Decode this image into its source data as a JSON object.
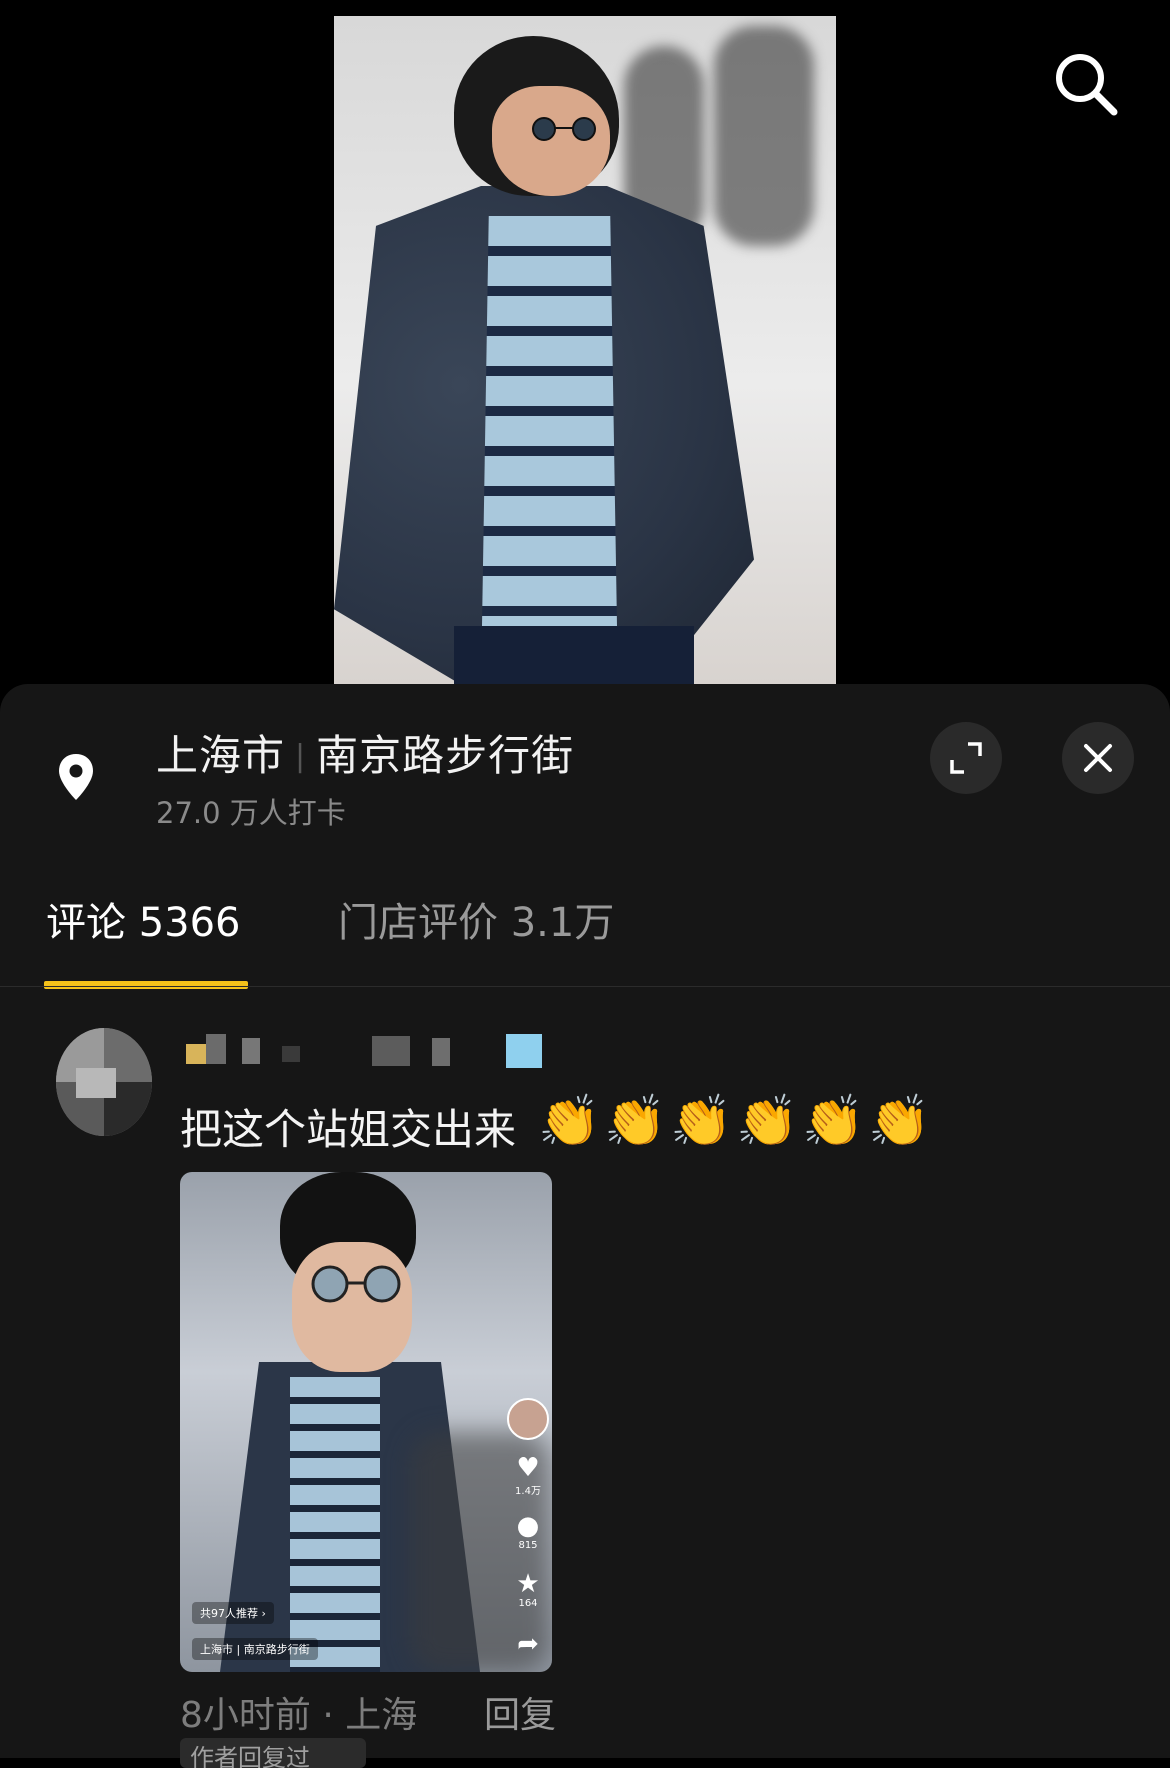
{
  "header": {
    "search_icon": "search-icon"
  },
  "location": {
    "city": "上海市",
    "place": "南京路步行街",
    "checkins": "27.0 万人打卡",
    "icon": "location-pin-icon",
    "expand_icon": "expand-icon",
    "close_icon": "close-icon"
  },
  "tabs": [
    {
      "label": "评论 5366",
      "active": true
    },
    {
      "label": "门店评价 3.1万",
      "active": false
    }
  ],
  "accent_color": "#f4c21a",
  "comment": {
    "text": "把这个站姐交出来",
    "emoji": [
      "👏",
      "👏",
      "👏",
      "👏",
      "👏",
      "👏"
    ],
    "time_location": "8小时前 · 上海",
    "reply_label": "回复",
    "author_badge": "作者回复过",
    "thumbnail": {
      "likes": "1.4万",
      "comments": "815",
      "favorites": "164",
      "recommend": "共97人推荐 ›",
      "location": "上海市 | 南京路步行街"
    }
  }
}
